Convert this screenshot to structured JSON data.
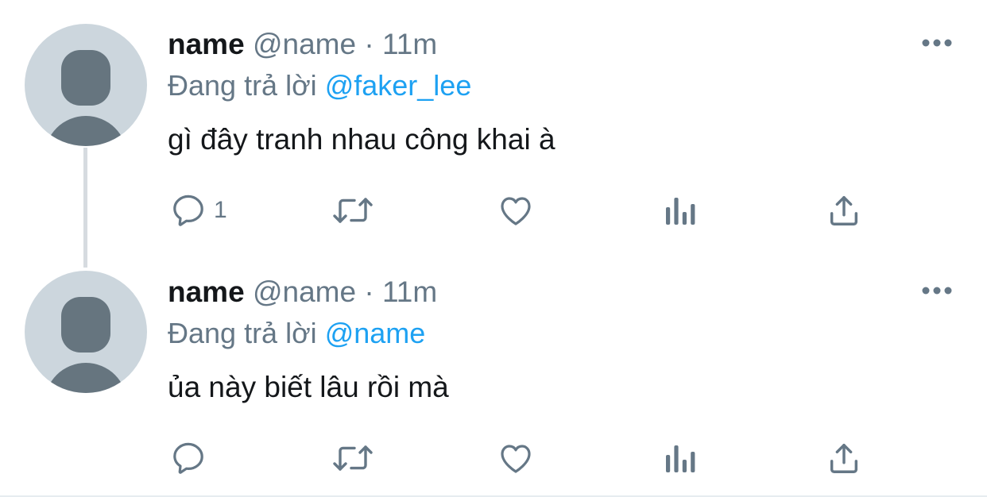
{
  "tweets": [
    {
      "name": "name",
      "handle": "@name",
      "separator": "·",
      "time": "11m",
      "reply_prefix": "Đang trả lời",
      "reply_to": "@faker_lee",
      "text": "gì đây tranh nhau công khai à",
      "reply_count": "1"
    },
    {
      "name": "name",
      "handle": "@name",
      "separator": "·",
      "time": "11m",
      "reply_prefix": "Đang trả lời",
      "reply_to": "@name",
      "text": "ủa này biết lâu rồi mà",
      "reply_count": ""
    }
  ],
  "icons": {
    "reply": "reply-icon",
    "retweet": "retweet-icon",
    "like": "heart-icon",
    "analytics": "analytics-icon",
    "share": "share-icon",
    "more": "more-icon",
    "avatar": "default-avatar-icon"
  },
  "colors": {
    "primary_text": "#14171a",
    "secondary_text": "#657786",
    "mention": "#1da1f2",
    "avatar_bg": "#ccd6dd",
    "avatar_figure": "#66757f",
    "thread_line": "#d6dbe0"
  }
}
